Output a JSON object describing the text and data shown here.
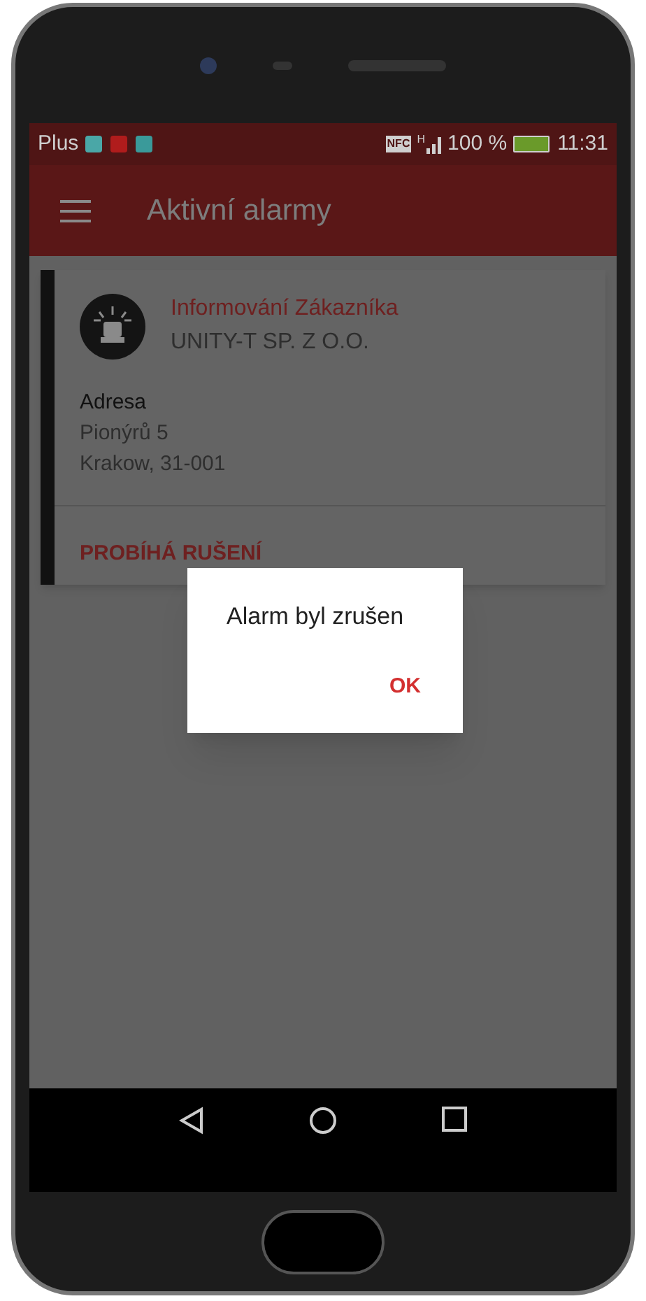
{
  "status_bar": {
    "carrier": "Plus",
    "nfc": "NFC",
    "network": "H",
    "battery": "100 %",
    "time": "11:31"
  },
  "app_bar": {
    "title": "Aktivní alarmy"
  },
  "alarm_card": {
    "title": "Informování Zákazníka",
    "company": "UNITY-T SP. Z O.O.",
    "address_label": "Adresa",
    "address_lines": [
      "Pionýrů 5",
      "Krakow, 31-001"
    ],
    "status": "PROBÍHÁ RUŠENÍ"
  },
  "dialog": {
    "message": "Alarm byl zrušen",
    "button": "OK"
  }
}
